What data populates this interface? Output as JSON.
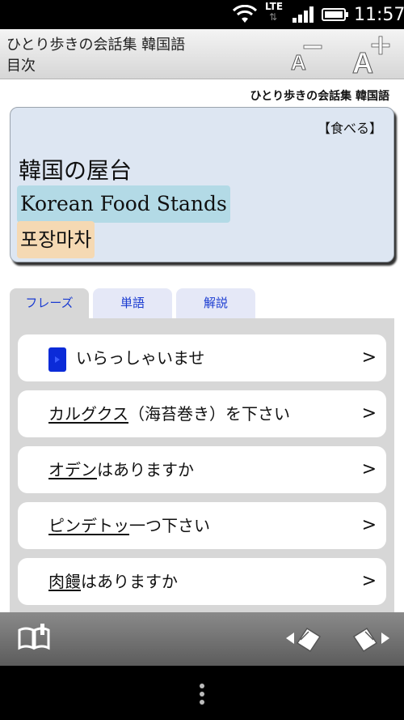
{
  "status_bar": {
    "network": "LTE",
    "time": "11:57",
    "icons": [
      "wifi-icon",
      "signal-icon",
      "battery-icon"
    ]
  },
  "header": {
    "title": "ひとり歩きの会話集 韓国語",
    "subtitle": "目次",
    "font_small_label": "A",
    "font_large_label": "A"
  },
  "book_name": "ひとり歩きの会話集 韓国語",
  "card": {
    "category": "【食べる】",
    "japanese": "韓国の屋台",
    "english": "Korean Food Stands",
    "korean": "포장마차",
    "colors": {
      "english_bg": "#b3dae6",
      "korean_bg": "#f5d9b3",
      "card_bg": "#dde6f2"
    }
  },
  "tabs": [
    {
      "label": "フレーズ",
      "active": true
    },
    {
      "label": "単語",
      "active": false
    },
    {
      "label": "解説",
      "active": false
    }
  ],
  "phrases": [
    {
      "underlined": "",
      "rest": "いらっしゃいませ",
      "chevron": ">"
    },
    {
      "underlined": "カルグクス",
      "rest": "（海苔巻き）を下さい",
      "chevron": ">"
    },
    {
      "underlined": "オデン",
      "rest": "はありますか",
      "chevron": ">"
    },
    {
      "underlined": "ピンデトッ",
      "rest": "一つ下さい",
      "chevron": ">"
    },
    {
      "underlined": "肉饅",
      "rest": "はありますか",
      "chevron": ">"
    }
  ],
  "bottom_bar": {
    "icons": [
      "book-icon",
      "prev-card-icon",
      "next-card-icon"
    ]
  }
}
